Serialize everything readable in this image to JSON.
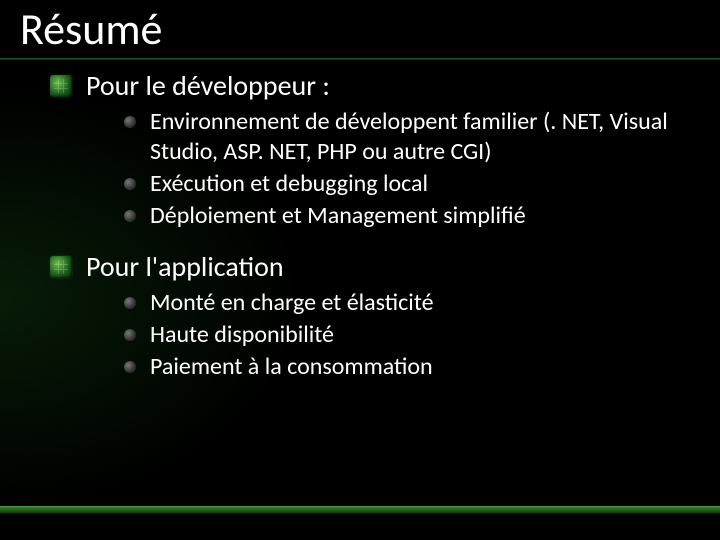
{
  "title": "Résumé",
  "sections": [
    {
      "heading": "Pour le développeur :",
      "items": [
        "Environnement de développent familier (. NET, Visual Studio, ASP. NET, PHP ou autre CGI)",
        "Exécution et debugging local",
        "Déploiement et Management simplifié"
      ]
    },
    {
      "heading": "Pour l'application",
      "items": [
        "Monté en charge et élasticité",
        "Haute disponibilité",
        "Paiement à la consommation"
      ]
    }
  ]
}
